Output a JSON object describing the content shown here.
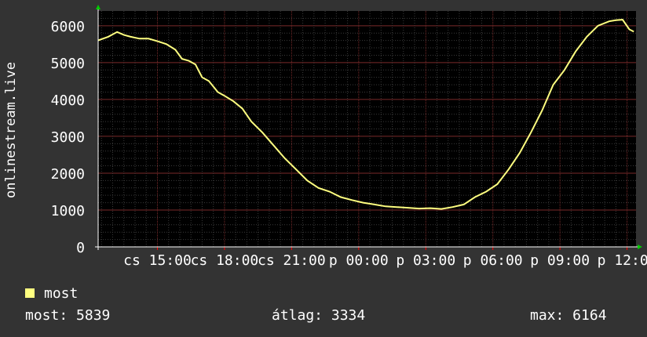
{
  "chart_data": {
    "type": "line",
    "ylabel": "onlinestream.live",
    "xlabel": "",
    "title": "",
    "ylim": [
      0,
      6400
    ],
    "yticks": [
      0,
      1000,
      2000,
      3000,
      4000,
      5000,
      6000
    ],
    "xtick_labels": [
      "cs 15:00",
      "cs 18:00",
      "cs 21:00",
      "p 00:00",
      "p 03:00",
      "p 06:00",
      "p 09:00",
      "p 12:00"
    ],
    "xtick_hours": [
      15,
      18,
      21,
      24,
      27,
      30,
      33,
      36
    ],
    "xlim_hours": [
      12.35,
      36.4
    ],
    "grid": true,
    "series": [
      {
        "name": "most",
        "color": "#ffff80",
        "x_hours": [
          12.35,
          12.8,
          13.2,
          13.5,
          13.8,
          14.2,
          14.6,
          15.0,
          15.4,
          15.8,
          16.1,
          16.4,
          16.7,
          17.0,
          17.3,
          17.7,
          18.0,
          18.4,
          18.8,
          19.2,
          19.7,
          20.2,
          20.7,
          21.2,
          21.7,
          22.2,
          22.7,
          23.2,
          23.7,
          24.2,
          24.7,
          25.2,
          25.7,
          26.2,
          26.7,
          27.2,
          27.7,
          28.2,
          28.7,
          29.2,
          29.7,
          30.2,
          30.7,
          31.2,
          31.7,
          32.2,
          32.7,
          33.2,
          33.7,
          34.2,
          34.7,
          35.2,
          35.5,
          35.8,
          36.1,
          36.3
        ],
        "values": [
          5600,
          5700,
          5830,
          5750,
          5700,
          5650,
          5650,
          5580,
          5500,
          5350,
          5100,
          5050,
          4950,
          4600,
          4500,
          4200,
          4100,
          3950,
          3750,
          3400,
          3100,
          2750,
          2400,
          2100,
          1800,
          1600,
          1500,
          1350,
          1270,
          1200,
          1150,
          1100,
          1080,
          1060,
          1040,
          1050,
          1030,
          1080,
          1150,
          1350,
          1500,
          1700,
          2100,
          2550,
          3100,
          3700,
          4400,
          4800,
          5300,
          5700,
          6000,
          6120,
          6150,
          6164,
          5900,
          5839
        ]
      }
    ]
  },
  "legend": {
    "label": "most",
    "color": "#ffff80"
  },
  "stats": {
    "current": "most: 5839",
    "average": "átlag: 3334",
    "max": "max: 6164"
  }
}
